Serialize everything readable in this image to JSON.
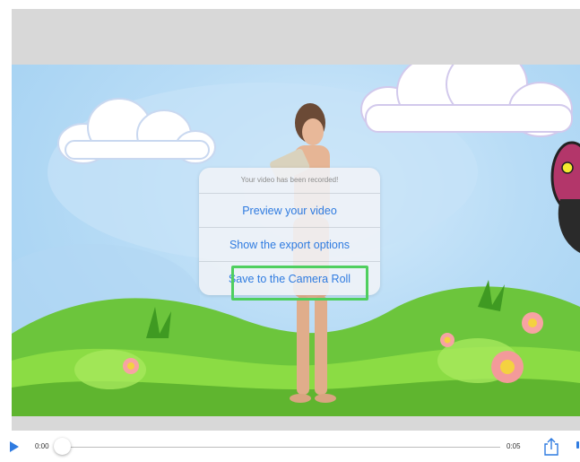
{
  "dialog": {
    "title": "Your video has been recorded!",
    "options": [
      "Preview your video",
      "Show the export options",
      "Save to the Camera Roll"
    ]
  },
  "player": {
    "current_time": "0:00",
    "duration": "0:05",
    "progress": 0
  },
  "icons": [
    "play-icon",
    "share-icon"
  ],
  "colors": {
    "accent": "#2f7be0",
    "highlight": "#4fcf5f",
    "chrome": "#d8d8d8"
  }
}
